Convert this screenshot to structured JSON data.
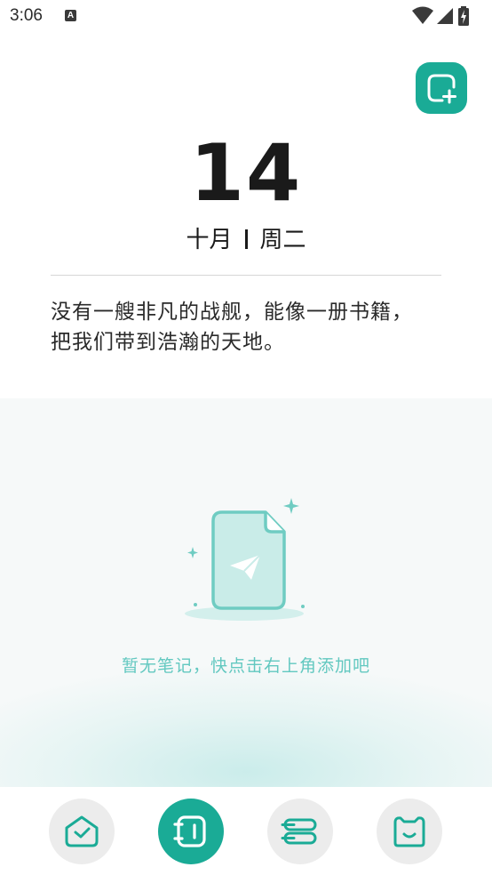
{
  "status_bar": {
    "time": "3:06",
    "notification_icon": "a-icon",
    "right_icons": [
      "wifi-icon",
      "signal-icon",
      "battery-charging-icon"
    ]
  },
  "header": {
    "add_button_icon": "add-note-icon"
  },
  "date": {
    "day": "14",
    "month": "十月",
    "weekday": "周二"
  },
  "quote": {
    "line1": "没有一艘非凡的战舰，能像一册书籍，",
    "line2": "把我们带到浩瀚的天地。"
  },
  "empty_state": {
    "icon": "empty-document-icon",
    "message": "暂无笔记，快点击右上角添加吧"
  },
  "bottom_nav": {
    "items": [
      {
        "name": "home",
        "icon": "home-check-icon",
        "active": false
      },
      {
        "name": "notes",
        "icon": "notebook-icon",
        "active": true
      },
      {
        "name": "categories",
        "icon": "stack-icon",
        "active": false
      },
      {
        "name": "profile",
        "icon": "mascot-icon",
        "active": false
      }
    ]
  },
  "colors": {
    "accent": "#1aab96",
    "empty_text": "#62c8c0",
    "nav_inactive_bg": "#ececec",
    "panel_bg": "#f6f9f9"
  }
}
